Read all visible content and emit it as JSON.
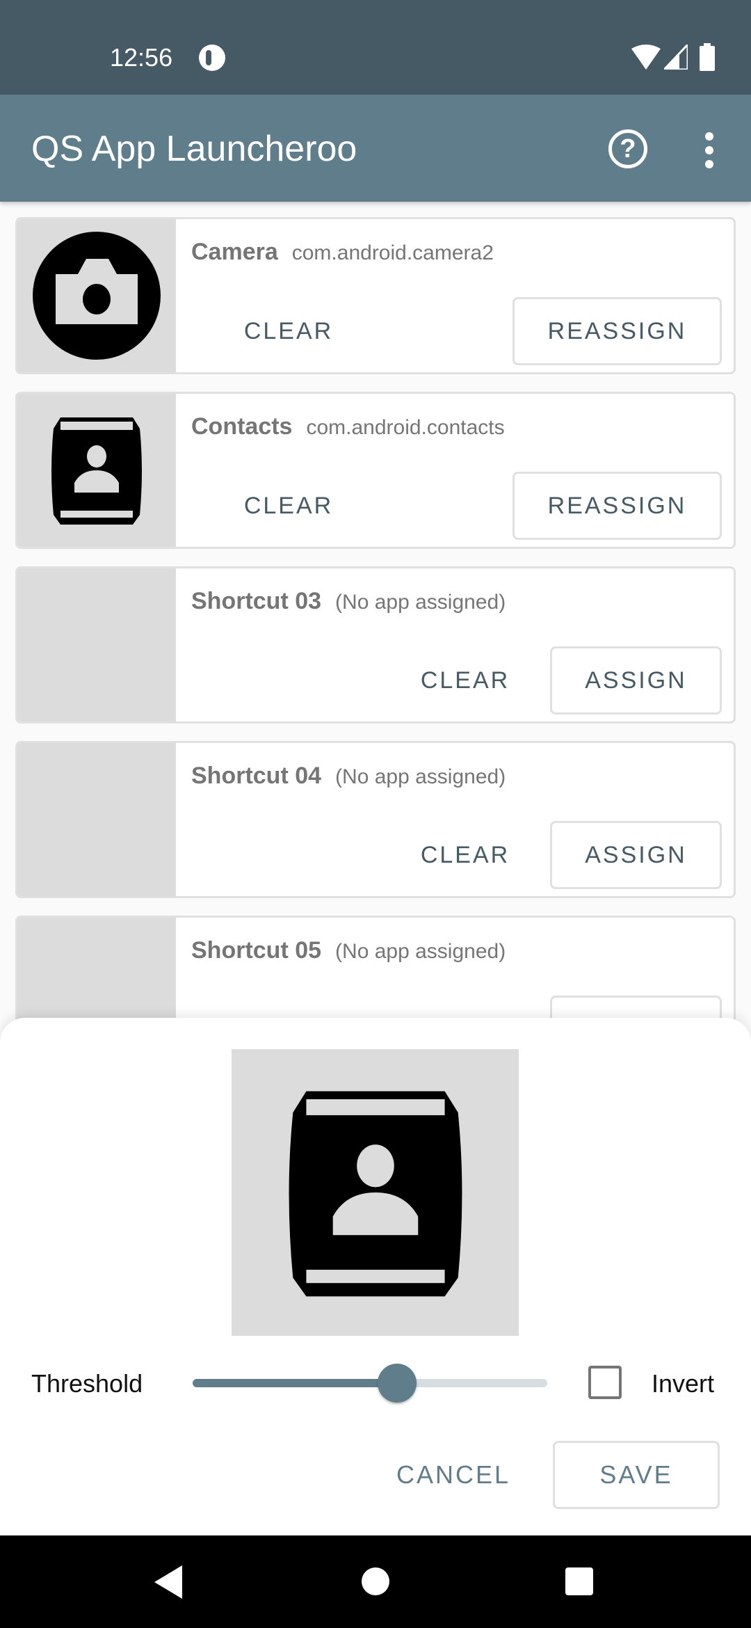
{
  "status": {
    "time": "12:56",
    "icons": [
      "notification-icon",
      "wifi-icon",
      "signal-icon",
      "battery-icon"
    ]
  },
  "appbar": {
    "title": "QS App Launcheroo",
    "help_icon": "help-circle-icon",
    "menu_icon": "more-vert-icon"
  },
  "cards": [
    {
      "name": "Camera",
      "package": "com.android.camera2",
      "clear": "CLEAR",
      "action": "REASSIGN",
      "icon": "camera-icon"
    },
    {
      "name": "Contacts",
      "package": "com.android.contacts",
      "clear": "CLEAR",
      "action": "REASSIGN",
      "icon": "contacts-icon"
    },
    {
      "name": "Shortcut 03",
      "package": "(No app assigned)",
      "clear": "CLEAR",
      "action": "ASSIGN"
    },
    {
      "name": "Shortcut 04",
      "package": "(No app assigned)",
      "clear": "CLEAR",
      "action": "ASSIGN"
    },
    {
      "name": "Shortcut 05",
      "package": "(No app assigned)"
    }
  ],
  "sheet": {
    "threshold_label": "Threshold",
    "threshold_value": 0.576,
    "invert_label": "Invert",
    "invert_checked": false,
    "cancel": "CANCEL",
    "save": "SAVE"
  },
  "colors": {
    "primary": "#607D8B",
    "primary_dark": "#455A64"
  }
}
